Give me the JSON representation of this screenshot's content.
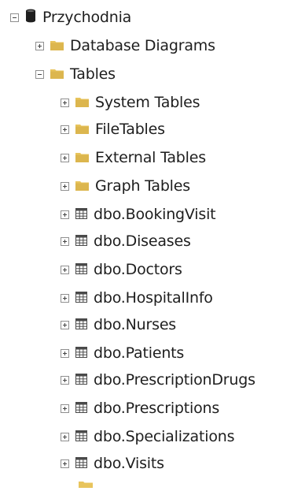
{
  "tree": {
    "database": {
      "label": "Przychodnia",
      "icon": "database-icon"
    },
    "database_diagrams": {
      "label": "Database Diagrams",
      "icon": "folder-icon"
    },
    "tables": {
      "label": "Tables",
      "icon": "folder-icon"
    },
    "table_folders": [
      {
        "label": "System Tables",
        "icon": "folder-icon"
      },
      {
        "label": "FileTables",
        "icon": "folder-icon"
      },
      {
        "label": "External Tables",
        "icon": "folder-icon"
      },
      {
        "label": "Graph Tables",
        "icon": "folder-icon"
      }
    ],
    "table_items": [
      {
        "label": "dbo.BookingVisit",
        "icon": "table-icon"
      },
      {
        "label": "dbo.Diseases",
        "icon": "table-icon"
      },
      {
        "label": "dbo.Doctors",
        "icon": "table-icon"
      },
      {
        "label": "dbo.HospitalInfo",
        "icon": "table-icon"
      },
      {
        "label": "dbo.Nurses",
        "icon": "table-icon"
      },
      {
        "label": "dbo.Patients",
        "icon": "table-icon"
      },
      {
        "label": "dbo.PrescriptionDrugs",
        "icon": "table-icon"
      },
      {
        "label": "dbo.Prescriptions",
        "icon": "table-icon"
      },
      {
        "label": "dbo.Specializations",
        "icon": "table-icon"
      },
      {
        "label": "dbo.Visits",
        "icon": "table-icon"
      }
    ]
  },
  "colors": {
    "folder": "#e8c45c",
    "database": "#1f1f1f",
    "table_icon": "#4a4a4a",
    "text": "#1e1e1e",
    "expander_border": "#8f8f8f"
  }
}
